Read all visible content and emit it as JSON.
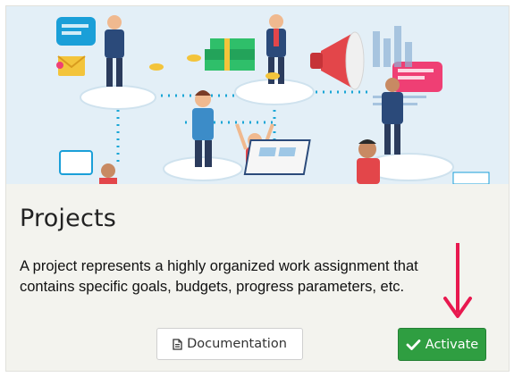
{
  "card": {
    "title": "Projects",
    "description": "A project represents a highly organized work assignment that contains specific goals, budgets, progress parameters, etc."
  },
  "buttons": {
    "documentation_label": "Documentation",
    "documentation_icon": "document-icon",
    "activate_label": "Activate",
    "activate_icon": "checkmark-icon"
  },
  "colors": {
    "activate": "#2f9e41",
    "annotation_arrow": "#e8194f"
  }
}
